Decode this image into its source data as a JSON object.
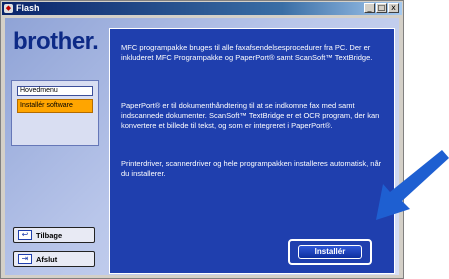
{
  "window": {
    "title": "Flash",
    "buttons": [
      "_",
      "□",
      "x"
    ]
  },
  "brand": "brother.",
  "menu": {
    "main": "Hovedmenu",
    "software": "Installér software"
  },
  "panel": {
    "p1": "MFC programpakke bruges til alle faxafsendelsesprocedurer fra PC. Der er inkluderet MFC Programpakke og PaperPort® samt ScanSoft™ TextBridge.",
    "p2": "PaperPort® er til dokumenthåndtering til at se indkomne fax med samt indscannede dokumenter. ScanSoft™ TextBridge er et OCR program, der kan konvertere et billede til tekst, og som er integreret i PaperPort®.",
    "p3": "Printerdriver, scannerdriver og hele programpakken installeres automatisk, når du installerer."
  },
  "install_label": "Installér",
  "nav": {
    "back": "Tilbage",
    "exit": "Afslut"
  },
  "colors": {
    "panel": "#1f3fae",
    "accent": "#ffa500",
    "arrow": "#1e5fd1"
  }
}
